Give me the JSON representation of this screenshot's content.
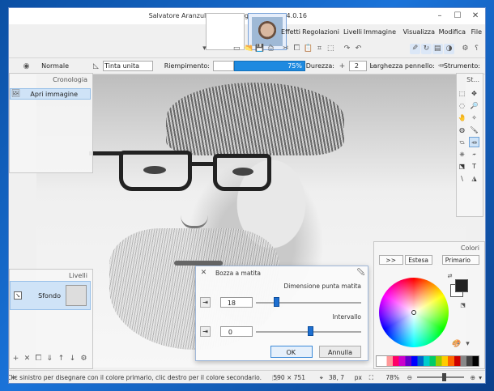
{
  "window": {
    "title": "Salvatore Aranzulla - Copia.jpg - paint.net 4.0.16",
    "min": "–",
    "max": "☐",
    "close": "✕"
  },
  "menu": {
    "items": [
      "File",
      "Modifica",
      "Visualizza",
      "Immagine",
      "Livelli",
      "Regolazioni",
      "Effetti"
    ]
  },
  "toolbar": {
    "line_width_label": "Larghezza pennello:",
    "line_width_value": "2",
    "duration_label": "Durezza:",
    "duration_value": "75%",
    "fill_label": "Riempimento:",
    "fill_value": "Tinta unita",
    "blend_value": "Normale",
    "tool_label": "Strumento:"
  },
  "panels": {
    "history_title": "Cronologia",
    "history_item": "Apri immagine",
    "tools_title": "St...",
    "layers_title": "Livelli",
    "layer_name": "Sfondo",
    "colors_title": "Colori",
    "primary_label": "Primario",
    "extend_label": "Estesa",
    "extend_arrows": ">>"
  },
  "dialog": {
    "title": "Bozza a matita",
    "tip_label": "Dimensione punta matita",
    "tip_value": "18",
    "range_label": "Intervallo",
    "range_value": "0",
    "ok": "OK",
    "cancel": "Annulla",
    "tip_slider_fraction": 0.22,
    "range_slider_fraction": 0.55
  },
  "status": {
    "hint": "Clic sinistro per disegnare con il colore primario, clic destro per il colore secondario.",
    "size": "590 × 751",
    "cursor": "38, 7",
    "unit": "px",
    "zoom": "78%"
  },
  "colors": {
    "accent": "#1e8ae0",
    "primary_swatch": "#222222",
    "secondary_swatch": "#ffffff"
  }
}
